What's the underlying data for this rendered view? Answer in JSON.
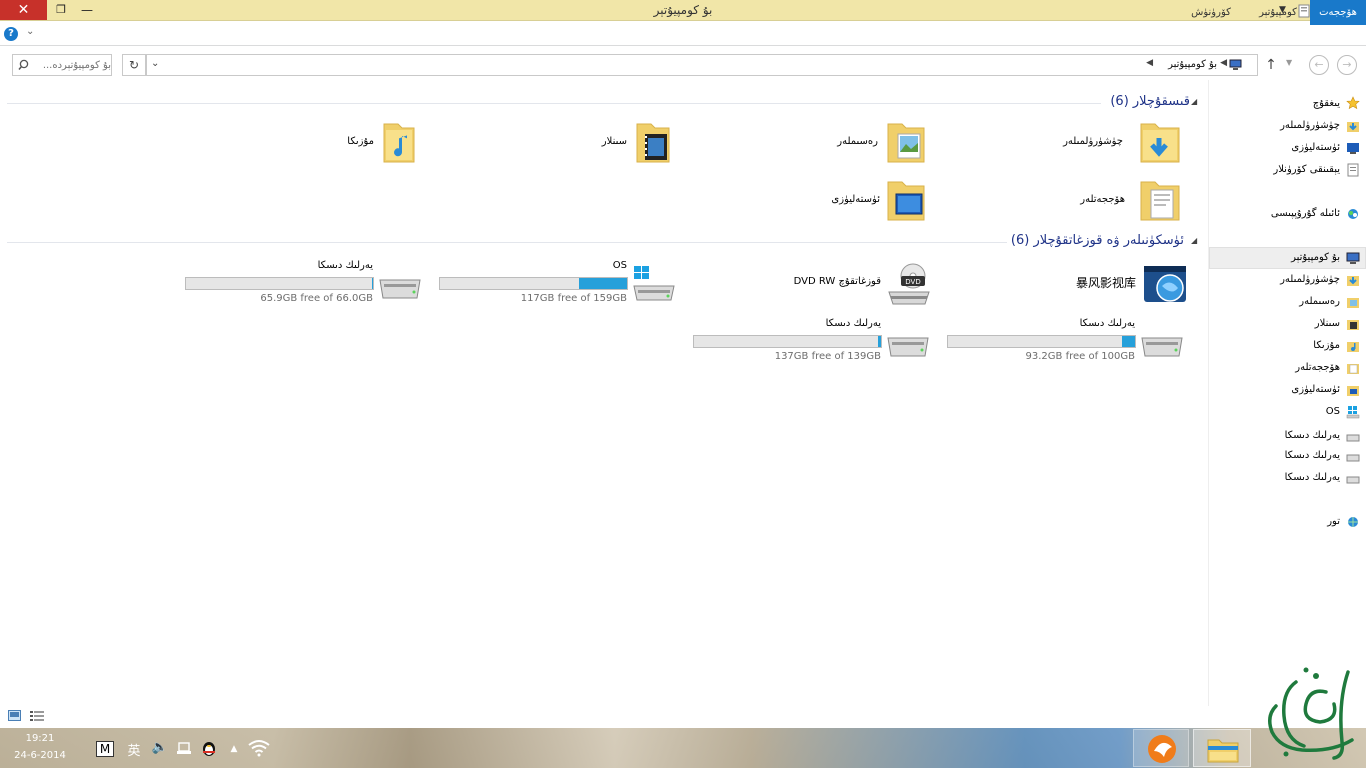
{
  "window": {
    "title": "بۇ كومپيۇتېر"
  },
  "ribbon": {
    "tabs": {
      "file": "ھۆججەت",
      "computer": "كومپيۇتېر",
      "view": "كۆرۈنۈش"
    }
  },
  "address": {
    "path": "بۇ كومپيۇتېر",
    "search_placeholder": "بۇ كومپيۇتېردە..."
  },
  "folders_group": {
    "header": "قىسقۇچلار (6)",
    "items": [
      {
        "label": "چۈشۈرۈلمىلەر",
        "icon": "downloads-folder-icon"
      },
      {
        "label": "رەسىملەر",
        "icon": "pictures-folder-icon"
      },
      {
        "label": "سىنلار",
        "icon": "videos-folder-icon"
      },
      {
        "label": "مۇزىكا",
        "icon": "music-folder-icon"
      },
      {
        "label": "ھۆججەتلەر",
        "icon": "documents-folder-icon"
      },
      {
        "label": "ئۈستەليۈزى",
        "icon": "desktop-folder-icon"
      }
    ]
  },
  "drives_group": {
    "header": "ئۈسكۈنىلەر ۋە قوزغاتقۇچلار (6)",
    "items": [
      {
        "name": "暴风影视库",
        "type": "media-library"
      },
      {
        "name": "قوزغاتقۇچ DVD RW",
        "type": "dvd"
      },
      {
        "name": "OS",
        "free": "117GB free of 159GB",
        "used_fraction": 0.26
      },
      {
        "name": "يەرلىك دىسكا",
        "free": "65.9GB free of 66.0GB",
        "used_fraction": 0.002
      },
      {
        "name": "يەرلىك دىسكا",
        "free": "93.2GB free of 100GB",
        "used_fraction": 0.07
      },
      {
        "name": "يەرلىك دىسكا",
        "free": "137GB free of 139GB",
        "used_fraction": 0.015
      }
    ]
  },
  "navpane": {
    "favorites": "يىغقۇچ",
    "fav_items": [
      "چۈشۈرۈلمىلەر",
      "ئۈستەليۈزى",
      "يېقىنقى كۆرۈنلار"
    ],
    "homegroup": "ئائىلە گۇرۇپپىسى",
    "this_pc": "بۇ كومپيۇتېر",
    "pc_items": [
      "چۈشۈرۈلمىلەر",
      "رەسىملەر",
      "سىنلار",
      "مۇزىكا",
      "ھۆججەتلەر",
      "ئۈستەليۈزى",
      "OS",
      "يەرلىك دىسكا",
      "يەرلىك دىسكا",
      "يەرلىك دىسكا"
    ],
    "network": "تور"
  },
  "taskbar": {
    "time": "19:21",
    "date": "24-6-2014",
    "ime_mode": "M",
    "ime_lang": "英"
  },
  "colors": {
    "accent": "#1979ca",
    "titlebar": "#f1e6a8",
    "close": "#c7312a",
    "bar_fill": "#26a0da"
  }
}
